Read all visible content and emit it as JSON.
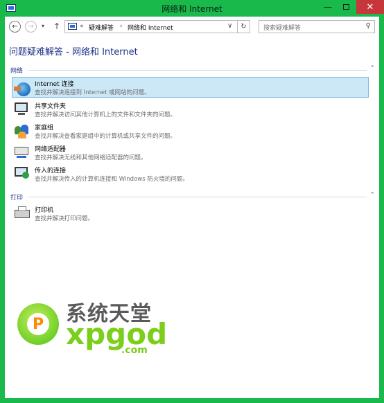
{
  "window": {
    "title": "网络和 Internet",
    "minimize_glyph": "—",
    "close_glyph": "✕"
  },
  "nav": {
    "back_glyph": "←",
    "forward_glyph": "→",
    "recent_glyph": "▾",
    "up_glyph": "↑",
    "address_prefix": "«",
    "breadcrumb": [
      "疑难解答",
      "网络和 Internet"
    ],
    "breadcrumb_separator": "›",
    "dropdown_glyph": "∨",
    "refresh_glyph": "↻",
    "search_placeholder": "搜索疑难解答",
    "search_glyph": "⚲"
  },
  "page": {
    "title": "问题疑难解答 - 网络和 Internet"
  },
  "groups": [
    {
      "label": "网络",
      "collapse_glyph": "⌃",
      "items": [
        {
          "title": "Internet 连接",
          "desc": "查找并解决连接到 Internet 或网站的问题。",
          "icon": "globe-icon",
          "selected": true
        },
        {
          "title": "共享文件夹",
          "desc": "查找并解决访问其他计算机上的文件和文件夹的问题。",
          "icon": "shared-folder-icon",
          "selected": false
        },
        {
          "title": "家庭组",
          "desc": "查找并解决查看家庭组中的计算机或共享文件的问题。",
          "icon": "homegroup-icon",
          "selected": false
        },
        {
          "title": "网络适配器",
          "desc": "查找并解决无线和其他网络适配器的问题。",
          "icon": "network-adapter-icon",
          "selected": false
        },
        {
          "title": "传入的连接",
          "desc": "查找并解决传入的计算机连接和 Windows 防火墙的问题。",
          "icon": "incoming-connections-icon",
          "selected": false
        }
      ]
    },
    {
      "label": "打印",
      "collapse_glyph": "⌃",
      "items": [
        {
          "title": "打印机",
          "desc": "查找并解决打印问题。",
          "icon": "printer-icon",
          "selected": false
        }
      ]
    }
  ],
  "watermark": {
    "logo_letter": "P",
    "cn_text": "系统天堂",
    "en_text": "xpgod",
    "domain": ".com"
  },
  "colors": {
    "frame": "#19b94b",
    "title_blue": "#1e3287",
    "selection": "#cce8f7",
    "close": "#c7363a",
    "watermark_green": "#7bcf1a"
  }
}
